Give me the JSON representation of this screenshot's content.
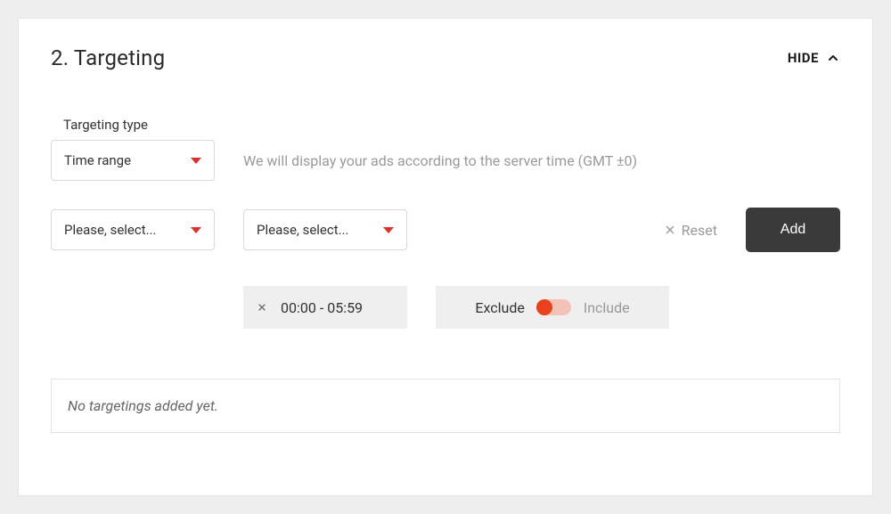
{
  "section": {
    "title": "2. Targeting",
    "hide_label": "HIDE"
  },
  "targeting_type": {
    "label": "Targeting type",
    "selected": "Time range",
    "help_text": "We will display your ads according to the server time (GMT ±0)"
  },
  "selectors": {
    "from_placeholder": "Please, select...",
    "to_placeholder": "Please, select..."
  },
  "actions": {
    "reset": "Reset",
    "add": "Add"
  },
  "chip": {
    "range": "00:00 - 05:59"
  },
  "toggle": {
    "left": "Exclude",
    "right": "Include",
    "state": "exclude"
  },
  "empty": {
    "message": "No targetings added yet."
  }
}
